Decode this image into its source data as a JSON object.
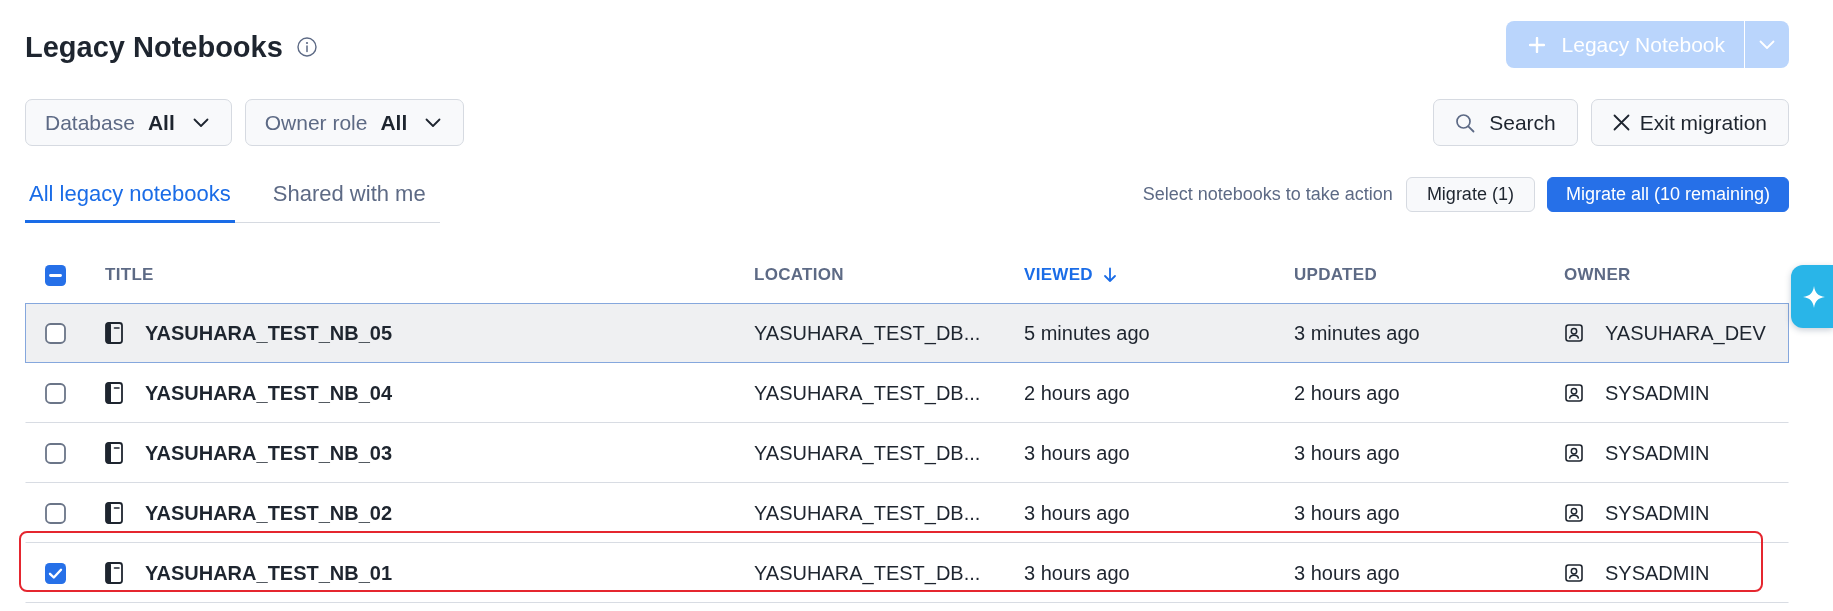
{
  "header": {
    "title": "Legacy Notebooks",
    "new_button": {
      "label": "Legacy Notebook",
      "disabled": true
    }
  },
  "filters": [
    {
      "label": "Database",
      "value": "All"
    },
    {
      "label": "Owner role",
      "value": "All"
    }
  ],
  "toolbar": [
    {
      "kind": "search",
      "label": "Search"
    },
    {
      "kind": "exit",
      "label": "Exit migration"
    }
  ],
  "tabs": [
    {
      "label": "All legacy notebooks",
      "selected": true
    },
    {
      "label": "Shared with me",
      "selected": false
    }
  ],
  "actions": {
    "hint": "Select notebooks to take action",
    "buttons": [
      {
        "kind": "secondary",
        "label": "Migrate (1)"
      },
      {
        "kind": "primary",
        "label": "Migrate all (10 remaining)"
      }
    ]
  },
  "table": {
    "select_all": {
      "checked": false,
      "indeterminate": true
    },
    "columns": [
      {
        "label": "TITLE",
        "sorted": false
      },
      {
        "label": "LOCATION",
        "sorted": false
      },
      {
        "label": "VIEWED",
        "sorted": true
      },
      {
        "label": "UPDATED",
        "sorted": false
      },
      {
        "label": "OWNER",
        "sorted": false
      }
    ],
    "rows": [
      {
        "title": "YASUHARA_TEST_NB_05",
        "location": "YASUHARA_TEST_DB...",
        "viewed": "5 minutes ago",
        "updated": "3 minutes ago",
        "owner": "YASUHARA_DEV",
        "selected": false,
        "focused": true,
        "marked": false
      },
      {
        "title": "YASUHARA_TEST_NB_04",
        "location": "YASUHARA_TEST_DB...",
        "viewed": "2 hours ago",
        "updated": "2 hours ago",
        "owner": "SYSADMIN",
        "selected": false,
        "focused": false,
        "marked": false
      },
      {
        "title": "YASUHARA_TEST_NB_03",
        "location": "YASUHARA_TEST_DB...",
        "viewed": "3 hours ago",
        "updated": "3 hours ago",
        "owner": "SYSADMIN",
        "selected": false,
        "focused": false,
        "marked": false
      },
      {
        "title": "YASUHARA_TEST_NB_02",
        "location": "YASUHARA_TEST_DB...",
        "viewed": "3 hours ago",
        "updated": "3 hours ago",
        "owner": "SYSADMIN",
        "selected": false,
        "focused": false,
        "marked": false
      },
      {
        "title": "YASUHARA_TEST_NB_01",
        "location": "YASUHARA_TEST_DB...",
        "viewed": "3 hours ago",
        "updated": "3 hours ago",
        "owner": "SYSADMIN",
        "selected": true,
        "focused": false,
        "marked": true
      }
    ]
  }
}
